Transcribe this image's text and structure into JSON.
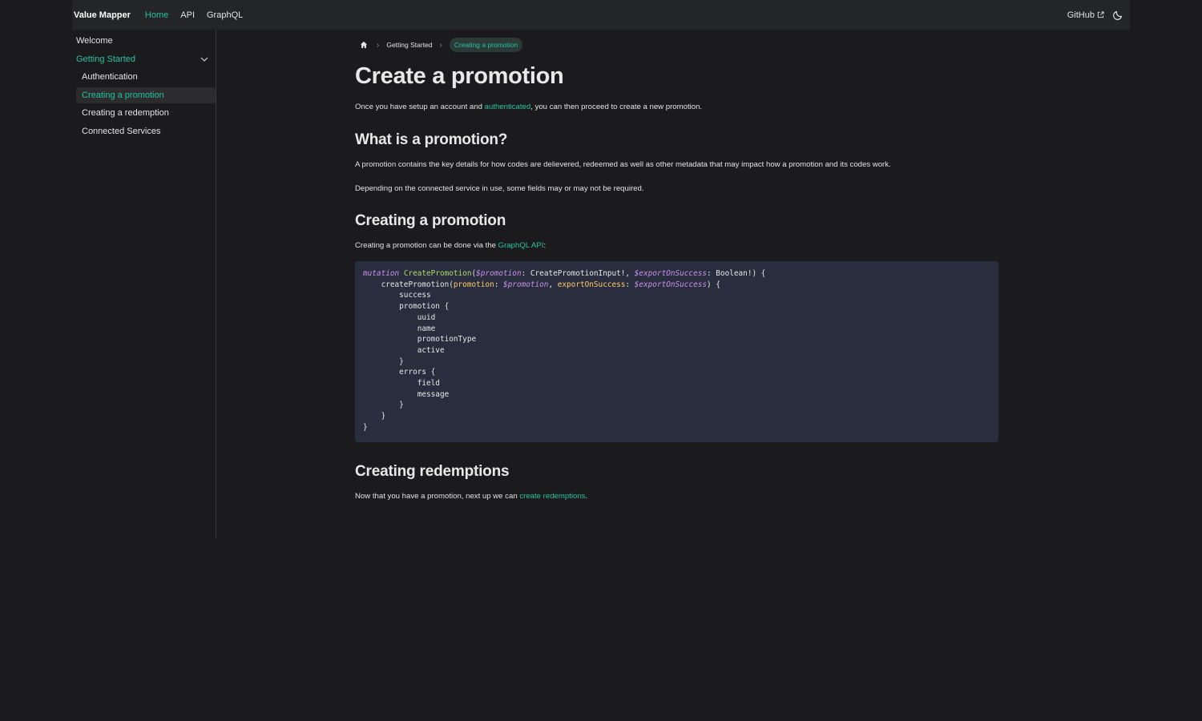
{
  "navbar": {
    "brand": "Value Mapper",
    "links": [
      "Home",
      "API",
      "GraphQL"
    ],
    "github": "GitHub",
    "accent": "#25c2a0"
  },
  "sidebar": {
    "items": [
      {
        "label": "Welcome"
      },
      {
        "label": "Getting Started"
      },
      {
        "label": "Authentication"
      },
      {
        "label": "Creating a promotion"
      },
      {
        "label": "Creating a redemption"
      },
      {
        "label": "Connected Services"
      }
    ]
  },
  "breadcrumb": {
    "items": [
      "Getting Started",
      "Creating a promotion"
    ]
  },
  "page": {
    "title": "Create a promotion",
    "intro": {
      "before": "Once you have setup an account and ",
      "link": "authenticated",
      "after": ", you can then proceed to create a new promotion."
    },
    "section1": {
      "heading": "What is a promotion?",
      "p1": "A promotion contains the key details for how codes are delievered, redeemed as well as other metadata that may impact how a promotion and its codes work.",
      "p2": "Depending on the connected service in use, some fields may or may not be required."
    },
    "section2": {
      "heading": "Creating a promotion",
      "before": "Creating a promotion can be done via the ",
      "link": "GraphQL API",
      "after": ":"
    },
    "code": {
      "l1_kw": "mutation",
      "l1_fn": "CreatePromotion",
      "l1_var1": "$promotion",
      "l1_mid": ": CreatePromotionInput!, ",
      "l1_var2": "$exportOnSuccess",
      "l1_end": ": Boolean!) {",
      "l2_fn": "createPromotion(",
      "l2_arg1": "promotion",
      "l2_var1": "$promotion",
      "l2_arg2": "exportOnSuccess",
      "l2_var2": "$exportOnSuccess",
      "l3": "success",
      "l4": "promotion {",
      "l5": "uuid",
      "l6": "name",
      "l7": "promotionType",
      "l8": "active",
      "l9": "}",
      "l10": "errors {",
      "l11": "field",
      "l12": "message",
      "l13": "}",
      "l14": "}",
      "l15": "}"
    },
    "section3": {
      "heading": "Creating redemptions",
      "before": "Now that you have a promotion, next up we can ",
      "link": "create redemptions",
      "after": "."
    }
  }
}
